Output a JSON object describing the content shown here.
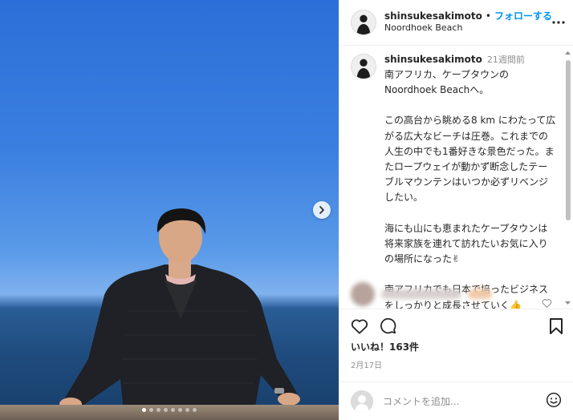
{
  "post": {
    "username": "shinsukesakimoto",
    "separator": "•",
    "follow_label": "フォローする",
    "location": "Noordhoek Beach"
  },
  "caption": {
    "username": "shinsukesakimoto",
    "time_ago": "21週間前",
    "lines": [
      "南アフリカ、ケープタウンの",
      "Noordhoek Beachへ。",
      "",
      "この高台から眺める8 km にわたって広",
      "がる広大なビーチは圧巻。これまでの",
      "人生の中でも1番好きな景色だった。ま",
      "たロープウェイが動かず断念したテー",
      "ブルマウンテンはいつか必ずリベンジ",
      "したい。",
      "",
      "海にも山にも恵まれたケープタウンは",
      "将来家族を連れて訪れたいお気に入り",
      "の場所になった✌",
      "",
      "南アフリカでも日本で培ったビジネス",
      "をしっかりと成長させていく👍"
    ]
  },
  "stats": {
    "likes": "いいね！163件",
    "date": "2月17日"
  },
  "comment_box": {
    "placeholder": "コメントを追加..."
  },
  "carousel": {
    "total_slides": 8,
    "active_index": 0
  },
  "icons": {
    "more": "more-options-icon",
    "like": "heart-icon",
    "comment": "comment-icon",
    "save": "bookmark-icon",
    "emoji": "smiley-icon",
    "next": "chevron-right-icon"
  },
  "colors": {
    "follow": "#0095f6",
    "sky_top": "#2c6fd8",
    "sea": "#1f4c7e"
  }
}
